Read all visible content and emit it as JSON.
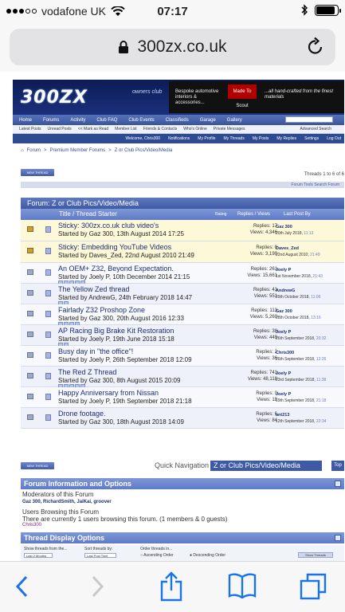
{
  "status_bar": {
    "carrier": "vodafone UK",
    "time": "07:17"
  },
  "browser": {
    "url": "300zx.co.uk",
    "icons": [
      "lock-icon",
      "reload-icon",
      "back-icon",
      "forward-icon",
      "share-icon",
      "bookmarks-icon",
      "tabs-icon"
    ]
  },
  "site": {
    "logo": "300ZX",
    "logo_sub": "owners club",
    "ad": {
      "left_text": "Bespoke automotive interiors & accessories...",
      "badge": "Made To Scout",
      "right_text": "...all hand-crafted from the finest materials"
    },
    "nav": [
      "Home",
      "Forums",
      "Activity",
      "Club FAQ",
      "Club Events",
      "Classifieds",
      "Garage",
      "Gallery"
    ],
    "subnav": [
      "Latest Posts",
      "Unread Posts",
      "<< Mark as Read",
      "Member List",
      "Friends & Contacts",
      "Who's Online",
      "Private Messages"
    ],
    "advanced_search": "Advanced Search",
    "userbar": [
      "Welcome, Chris300",
      "Notifications",
      "My Profile",
      "My Threads",
      "My Posts",
      "My Replies",
      "Settings",
      "Log Out"
    ],
    "breadcrumb": [
      "Forum",
      "Premium Member Forums",
      "Z or Club Pics/Video/Media"
    ],
    "new_thread": "NEW THREAD",
    "thread_count": "Threads 1 to 6 of 6",
    "tools": "Forum Tools    Search Forum",
    "forum_heading": "Forum: Z or Club Pics/Video/Media",
    "columns": {
      "title": "Title / Thread Starter",
      "rating": "Rating",
      "replies": "Replies / Views",
      "last": "Last Post By"
    }
  },
  "threads": [
    {
      "title": "Sticky: 300zx.co.uk club video's",
      "starter": "Started by Gaz 300, 13th August 2014 17:25",
      "replies": "Replies: 17",
      "views": "Views: 4,346",
      "last_by": "Gaz 300",
      "last_date": "20th July 2018,",
      "last_time": "11:13",
      "sticky": true,
      "pages": 0
    },
    {
      "title": "Sticky: Embedding YouTube Videos",
      "starter": "Started by Daves_Zed, 22nd August 2010 21:49",
      "replies": "Replies: 0",
      "views": "Views: 3,190",
      "last_by": "Daves_Zed",
      "last_date": "22nd August 2010,",
      "last_time": "21:49",
      "sticky": true,
      "pages": 0
    },
    {
      "title": "An OEM+ Z32, Beyond Expectation.",
      "starter": "Started by Joely P, 10th December 2014 21:15",
      "replies": "Replies: 261",
      "views": "Views: 15,661",
      "last_by": "Joely P",
      "last_date": "1st November 2018,",
      "last_time": "21:43",
      "sticky": false,
      "pages": 5
    },
    {
      "title": "The Yellow Zed thread",
      "starter": "Started by AndrewG, 24th February 2018 14:47",
      "replies": "Replies: 41",
      "views": "Views: 551",
      "last_by": "AndrewG",
      "last_date": "29th October 2018,",
      "last_time": "11:06",
      "sticky": false,
      "pages": 2
    },
    {
      "title": "Fairlady Z32 Proshop Zone",
      "starter": "Started by Gaz 300, 20th August 2016 12:33",
      "replies": "Replies: 113",
      "views": "Views: 5,260",
      "last_by": "Gaz 300",
      "last_date": "28th October 2018,",
      "last_time": "13:16",
      "sticky": false,
      "pages": 4
    },
    {
      "title": "AP Racing Big Brake Kit Restoration",
      "starter": "Started by Joely P, 19th June 2018 15:18",
      "replies": "Replies: 38",
      "views": "Views: 449",
      "last_by": "Joely P",
      "last_date": "26th September 2018,",
      "last_time": "20:32",
      "sticky": false,
      "pages": 2
    },
    {
      "title": "Busy day in \"the office\"!",
      "starter": "Started by Joely P, 26th September 2018 12:09",
      "replies": "Replies: 2",
      "views": "Views: 36",
      "last_by": "Chris300",
      "last_date": "26th September 2018,",
      "last_time": "12:26",
      "sticky": false,
      "pages": 0
    },
    {
      "title": "The Red Z Thread",
      "starter": "Started by Gaz 300, 8th August 2015 20:09",
      "replies": "Replies: 741",
      "views": "Views: 48,118",
      "last_by": "Joely P",
      "last_date": "23rd September 2018,",
      "last_time": "11:38",
      "sticky": false,
      "pages": 5
    },
    {
      "title": "Happy Anniversary from Nissan",
      "starter": "Started by Joely P, 19th September 2018 21:18",
      "replies": "Replies: 0",
      "views": "Views: 18",
      "last_by": "Joely P",
      "last_date": "19th September 2018,",
      "last_time": "21:18",
      "sticky": false,
      "pages": 0
    },
    {
      "title": "Drone footage.",
      "starter": "Started by Gaz 300, 18th August 2018 14:09",
      "replies": "Replies: 6",
      "views": "Views: 84",
      "last_by": "ant213",
      "last_date": "12th September 2018,",
      "last_time": "22:34",
      "sticky": false,
      "pages": 0
    }
  ],
  "quick_nav": {
    "label": "Quick Navigation",
    "selected": "Z or Club Pics/Video/Media",
    "top": "Top"
  },
  "forum_info": {
    "heading": "Forum Information and Options",
    "moderators_label": "Moderators of this Forum",
    "moderators": "Gaz 300, RichardSmith, JaiKai, groover",
    "browsing_label": "Users Browsing this Forum",
    "browsing_text": "There are currently 1 users browsing this forum. (1 members & 0 guests)",
    "browsing_user": "Chris300"
  },
  "display_options": {
    "heading": "Thread Display Options",
    "show_from_label": "Show threads from the...",
    "show_from_value": "Last 2 Months",
    "sort_label": "Sort threads by:",
    "sort_value": "Last Post Time",
    "order_label": "Order threads in...",
    "ascending": "Ascending Order",
    "descending": "Descending Order",
    "show_button": "Show Threads"
  }
}
